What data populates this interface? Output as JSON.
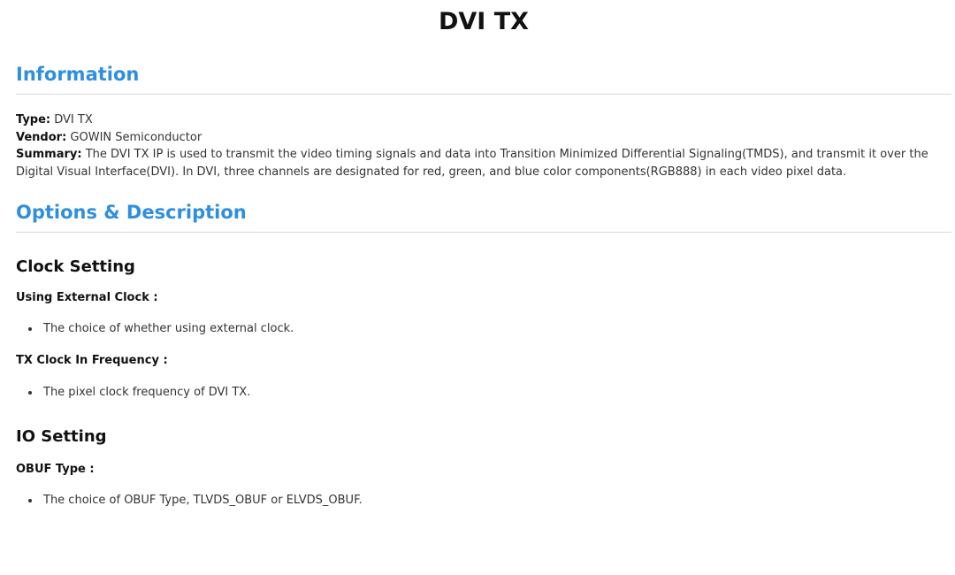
{
  "page": {
    "title": "DVI TX"
  },
  "information": {
    "heading": "Information",
    "type_label": "Type:",
    "type_value": " DVI TX",
    "vendor_label": "Vendor:",
    "vendor_value": " GOWIN Semiconductor",
    "summary_label": "Summary:",
    "summary_value": " The DVI TX IP is used to transmit the video timing signals and data into Transition Minimized Differential Signaling(TMDS), and transmit it over the Digital Visual Interface(DVI). In DVI, three channels are designated for red, green, and blue color components(RGB888) in each video pixel data."
  },
  "options": {
    "heading": "Options & Description",
    "clock_setting": {
      "heading": "Clock Setting",
      "using_external_clock": {
        "name": "Using External Clock :",
        "description": "The choice of whether using external clock."
      },
      "tx_clock_in_frequency": {
        "name": "TX Clock In Frequency :",
        "description": "The pixel clock frequency of DVI TX."
      }
    },
    "io_setting": {
      "heading": "IO Setting",
      "obuf_type": {
        "name": "OBUF Type :",
        "description": "The choice of OBUF Type, TLVDS_OBUF or ELVDS_OBUF."
      }
    }
  },
  "colors": {
    "section_heading": "#2f8fde",
    "text": "#333333",
    "divider": "#dcdcdc"
  }
}
